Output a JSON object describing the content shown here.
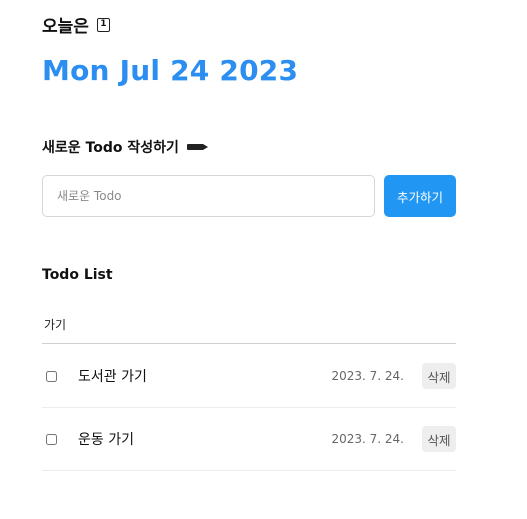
{
  "header": {
    "today_label": "오늘은",
    "calendar_icon_text": "1",
    "date": "Mon Jul 24 2023",
    "accent_color": "#2b8ef0"
  },
  "editor": {
    "title": "새로운 Todo 작성하기",
    "icon": "pencil-icon",
    "input_placeholder": "새로운 Todo",
    "input_value": "",
    "add_button_label": "추가하기",
    "add_button_color": "#2196f3"
  },
  "list": {
    "title": "Todo List",
    "search_value": "가기",
    "items": [
      {
        "checked": false,
        "content": "도서관 가기",
        "date": "2023. 7. 24.",
        "delete_label": "삭제"
      },
      {
        "checked": false,
        "content": "운동 가기",
        "date": "2023. 7. 24.",
        "delete_label": "삭제"
      }
    ]
  }
}
